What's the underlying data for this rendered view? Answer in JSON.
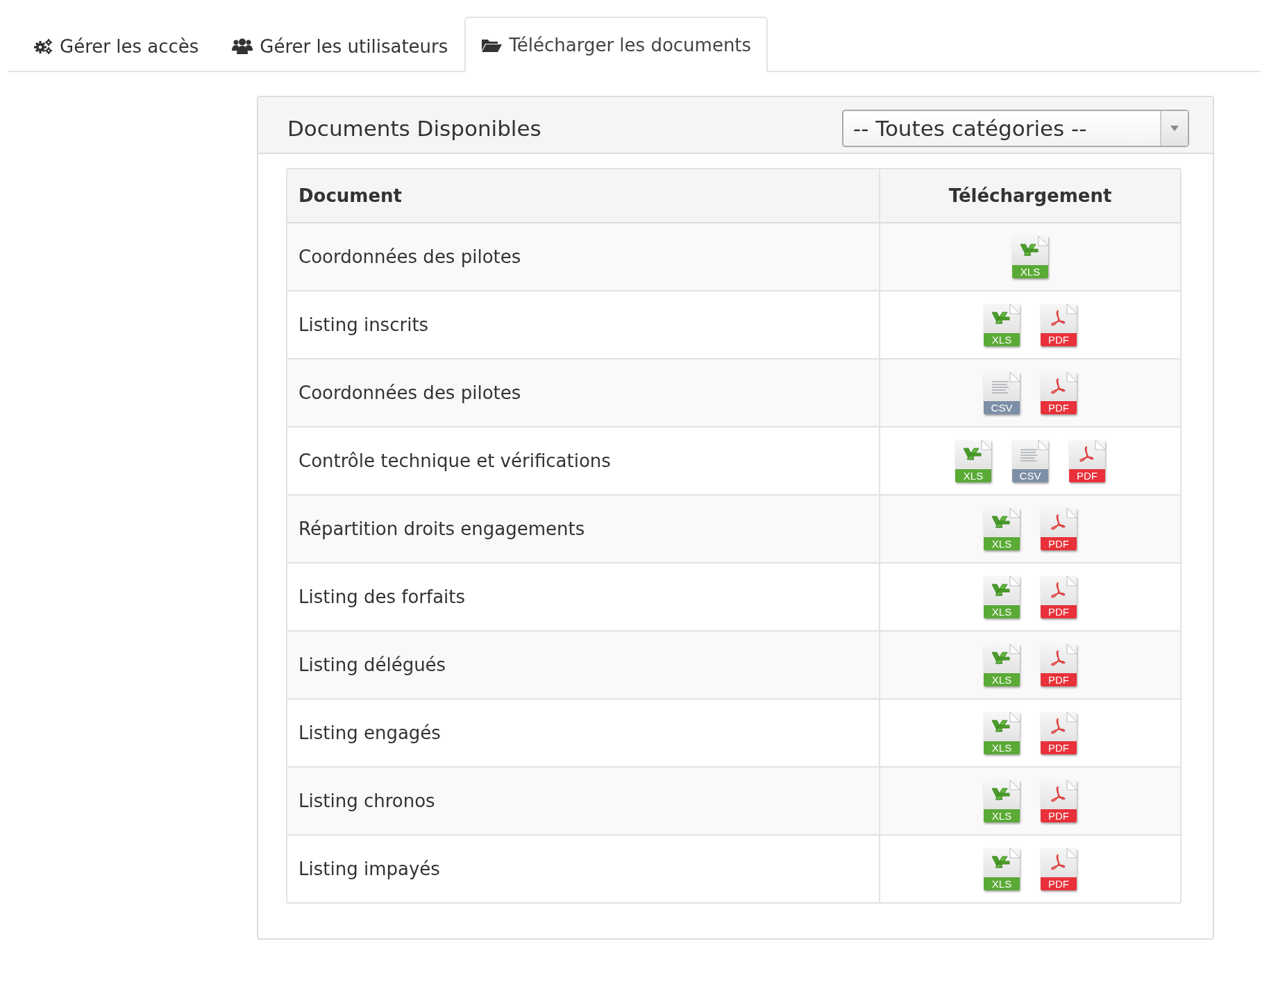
{
  "tabs": [
    {
      "label": "Gérer les accès",
      "kind": "access",
      "selected": false
    },
    {
      "label": "Gérer les utilisateurs",
      "kind": "users",
      "selected": false
    },
    {
      "label": "Télécharger les documents",
      "kind": "documents",
      "selected": true
    }
  ],
  "panel": {
    "title": "Documents Disponibles",
    "category_select": {
      "value": "-- Toutes catégories --"
    }
  },
  "table": {
    "columns": [
      "Document",
      "Téléchargement"
    ],
    "rows": [
      {
        "document": "Coordonnées des pilotes",
        "files": [
          {
            "kind": "xls",
            "label": "XLS"
          }
        ]
      },
      {
        "document": "Listing inscrits",
        "files": [
          {
            "kind": "xls",
            "label": "XLS"
          },
          {
            "kind": "pdf",
            "label": "PDF"
          }
        ]
      },
      {
        "document": "Coordonnées des pilotes",
        "files": [
          {
            "kind": "csv",
            "label": "CSV"
          },
          {
            "kind": "pdf",
            "label": "PDF"
          }
        ]
      },
      {
        "document": "Contrôle technique et vérifications",
        "files": [
          {
            "kind": "xls",
            "label": "XLS"
          },
          {
            "kind": "csv",
            "label": "CSV"
          },
          {
            "kind": "pdf",
            "label": "PDF"
          }
        ]
      },
      {
        "document": "Répartition droits engagements",
        "files": [
          {
            "kind": "xls",
            "label": "XLS"
          },
          {
            "kind": "pdf",
            "label": "PDF"
          }
        ]
      },
      {
        "document": "Listing des forfaits",
        "files": [
          {
            "kind": "xls",
            "label": "XLS"
          },
          {
            "kind": "pdf",
            "label": "PDF"
          }
        ]
      },
      {
        "document": "Listing délégués",
        "files": [
          {
            "kind": "xls",
            "label": "XLS"
          },
          {
            "kind": "pdf",
            "label": "PDF"
          }
        ]
      },
      {
        "document": "Listing engagés",
        "files": [
          {
            "kind": "xls",
            "label": "XLS"
          },
          {
            "kind": "pdf",
            "label": "PDF"
          }
        ]
      },
      {
        "document": "Listing chronos",
        "files": [
          {
            "kind": "xls",
            "label": "XLS"
          },
          {
            "kind": "pdf",
            "label": "PDF"
          }
        ]
      },
      {
        "document": "Listing impayés",
        "files": [
          {
            "kind": "xls",
            "label": "XLS"
          },
          {
            "kind": "pdf",
            "label": "PDF"
          }
        ]
      }
    ]
  }
}
